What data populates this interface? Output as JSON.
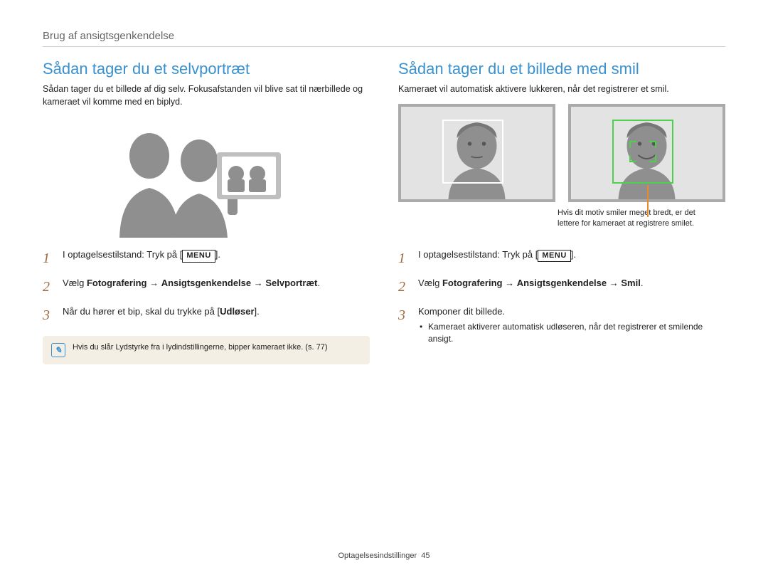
{
  "breadcrumb": "Brug af ansigtsgenkendelse",
  "left": {
    "heading": "Sådan tager du et selvportræt",
    "intro": "Sådan tager du et billede af dig selv. Fokusafstanden vil blive sat til nærbillede og kameraet vil komme med en biplyd.",
    "steps": [
      {
        "pre": "I optagelsestilstand: Tryk på [",
        "menu": "MENU",
        "post": "]."
      },
      {
        "text_before": "Vælg ",
        "bold1": "Fotografering",
        "arrow1": " → ",
        "bold2": "Ansigtsgenkendelse",
        "arrow2": " → ",
        "bold3": "Selvportræt",
        "text_after": "."
      },
      {
        "pre": "Når du hører et bip, skal du trykke på [",
        "bold": "Udløser",
        "post": "]."
      }
    ],
    "note": "Hvis du slår Lydstyrke fra i lydindstillingerne, bipper kameraet ikke. (s. 77)",
    "note_bold": "Lydstyrke"
  },
  "right": {
    "heading": "Sådan tager du et billede med smil",
    "intro": "Kameraet vil automatisk aktivere lukkeren, når det registrerer et smil.",
    "caption": "Hvis dit motiv smiler meget bredt, er det lettere for kameraet at registrere smilet.",
    "steps": [
      {
        "pre": "I optagelsestilstand: Tryk på [",
        "menu": "MENU",
        "post": "]."
      },
      {
        "text_before": "Vælg ",
        "bold1": "Fotografering",
        "arrow1": " → ",
        "bold2": "Ansigtsgenkendelse",
        "arrow2": " → ",
        "bold3": "Smil",
        "text_after": "."
      },
      {
        "simple": "Komponer dit billede.",
        "bullet": "Kameraet aktiverer automatisk udløseren, når det registrerer et smilende ansigt."
      }
    ]
  },
  "footer": {
    "label": "Optagelsesindstillinger",
    "page": "45"
  }
}
